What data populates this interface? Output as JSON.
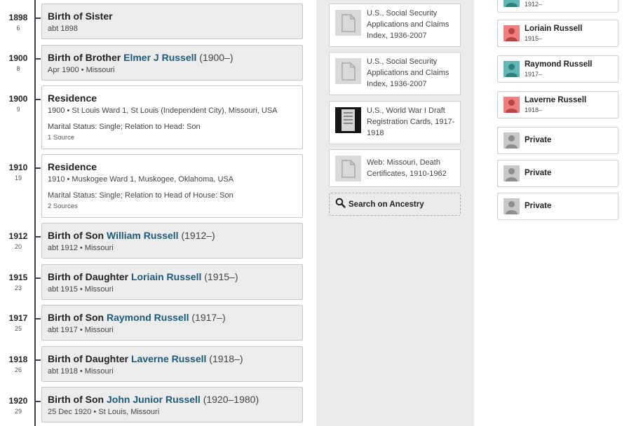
{
  "timeline": {
    "events": [
      {
        "year": "1898",
        "age": "6",
        "pre": "Birth of Sister",
        "person": "",
        "span": "",
        "sub": "abt 1898"
      },
      {
        "year": "1900",
        "age": "8",
        "pre": "Birth of Brother ",
        "person": "Elmer J Russell",
        "span": " (1900–)",
        "sub": "Apr 1900 • Missouri"
      },
      {
        "year": "1900",
        "age": "9",
        "pre": "Residence",
        "person": "",
        "span": "",
        "sub": "1900 • St Louis Ward 1, St Louis (Independent City), Missouri, USA",
        "detail": "Marital Status: Single; Relation to Head: Son",
        "sources": "1 Source"
      },
      {
        "year": "1910",
        "age": "19",
        "pre": "Residence",
        "person": "",
        "span": "",
        "sub": "1910 • Muskogee Ward 1, Muskogee, Oklahoma, USA",
        "detail": "Marital Status: Single; Relation to Head of House: Son",
        "sources": "2 Sources"
      },
      {
        "year": "1912",
        "age": "20",
        "pre": "Birth of Son ",
        "person": "William Russell",
        "span": " (1912–)",
        "sub": "abt 1912 • Missouri"
      },
      {
        "year": "1915",
        "age": "23",
        "pre": "Birth of Daughter ",
        "person": "Loriain Russell",
        "span": " (1915–)",
        "sub": "abt 1915 • Missouri"
      },
      {
        "year": "1917",
        "age": "25",
        "pre": "Birth of Son ",
        "person": "Raymond Russell",
        "span": " (1917–)",
        "sub": "abt 1917 • Missouri"
      },
      {
        "year": "1918",
        "age": "26",
        "pre": "Birth of Daughter ",
        "person": "Laverne Russell",
        "span": " (1918–)",
        "sub": "abt 1918 • Missouri"
      },
      {
        "year": "1920",
        "age": "29",
        "pre": "Birth of Son ",
        "person": "John Junior Russell",
        "span": " (1920–1980)",
        "sub": "25 Dec 1920 • St Louis, Missouri"
      }
    ]
  },
  "sources": {
    "items": [
      {
        "title": "U.S., Social Security Applications and Claims Index, 1936-2007",
        "thumb": "document-icon"
      },
      {
        "title": "U.S., Social Security Applications and Claims Index, 1936-2007",
        "thumb": "document-icon"
      },
      {
        "title": "U.S., World War I Draft Registration Cards, 1917-1918",
        "thumb": "record-image"
      },
      {
        "title": "Web: Missouri, Death Certificates, 1910-1962",
        "thumb": "document-icon"
      }
    ],
    "search_label": "Search on Ancestry"
  },
  "family": {
    "members": [
      {
        "name": "",
        "dates": "1912–",
        "gender": "male"
      },
      {
        "name": "Loriain Russell",
        "dates": "1915–",
        "gender": "female"
      },
      {
        "name": "Raymond Russell",
        "dates": "1917–",
        "gender": "male"
      },
      {
        "name": "Laverne Russell",
        "dates": "1918–",
        "gender": "female"
      },
      {
        "name": "Private",
        "dates": "",
        "gender": "unknown"
      },
      {
        "name": "Private",
        "dates": "",
        "gender": "unknown"
      },
      {
        "name": "Private",
        "dates": "",
        "gender": "unknown"
      }
    ]
  },
  "colors": {
    "timeline_line": "#3b4350",
    "person_link": "#1d5a7a",
    "male_avatar": "#5fb8b6",
    "female_avatar": "#f07e7e",
    "unknown_avatar": "#c8c8c8",
    "sources_bg": "#ebebeb",
    "event_card_bg": "#ececec"
  }
}
